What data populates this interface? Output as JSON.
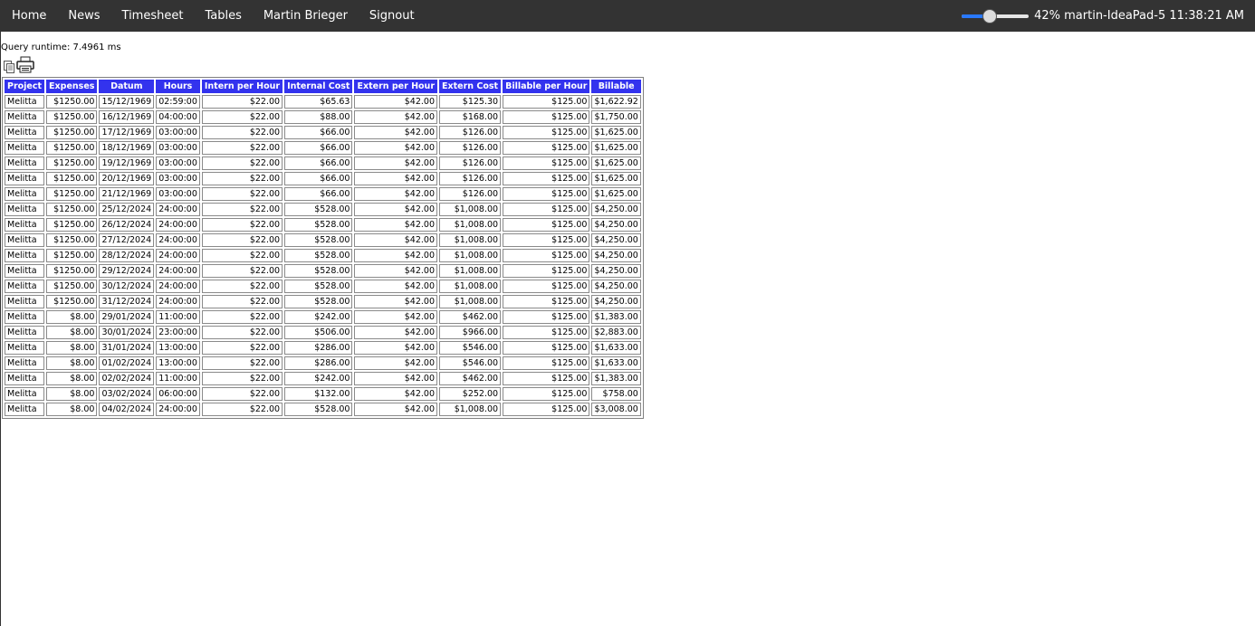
{
  "nav": {
    "items": [
      "Home",
      "News",
      "Timesheet",
      "Tables",
      "Martin Brieger",
      "Signout"
    ]
  },
  "status": {
    "volume_fraction": 0.42,
    "text": "42% martin-IdeaPad-5 11:38:21 AM"
  },
  "runtime": "Query runtime: 7.4961 ms",
  "icons": {
    "copy": "copy-icon",
    "print": "printer-icon"
  },
  "colors": {
    "topbar": "#333333",
    "header": "#3333ee",
    "slider": "#2979ff"
  },
  "table": {
    "headers": [
      "Project",
      "Expenses",
      "Datum",
      "Hours",
      "Intern per Hour",
      "Internal Cost",
      "Extern per Hour",
      "Extern Cost",
      "Billable per Hour",
      "Billable"
    ],
    "rows": [
      [
        "Melitta",
        "$1250.00",
        "15/12/1969",
        "02:59:00",
        "$22.00",
        "$65.63",
        "$42.00",
        "$125.30",
        "$125.00",
        "$1,622.92"
      ],
      [
        "Melitta",
        "$1250.00",
        "16/12/1969",
        "04:00:00",
        "$22.00",
        "$88.00",
        "$42.00",
        "$168.00",
        "$125.00",
        "$1,750.00"
      ],
      [
        "Melitta",
        "$1250.00",
        "17/12/1969",
        "03:00:00",
        "$22.00",
        "$66.00",
        "$42.00",
        "$126.00",
        "$125.00",
        "$1,625.00"
      ],
      [
        "Melitta",
        "$1250.00",
        "18/12/1969",
        "03:00:00",
        "$22.00",
        "$66.00",
        "$42.00",
        "$126.00",
        "$125.00",
        "$1,625.00"
      ],
      [
        "Melitta",
        "$1250.00",
        "19/12/1969",
        "03:00:00",
        "$22.00",
        "$66.00",
        "$42.00",
        "$126.00",
        "$125.00",
        "$1,625.00"
      ],
      [
        "Melitta",
        "$1250.00",
        "20/12/1969",
        "03:00:00",
        "$22.00",
        "$66.00",
        "$42.00",
        "$126.00",
        "$125.00",
        "$1,625.00"
      ],
      [
        "Melitta",
        "$1250.00",
        "21/12/1969",
        "03:00:00",
        "$22.00",
        "$66.00",
        "$42.00",
        "$126.00",
        "$125.00",
        "$1,625.00"
      ],
      [
        "Melitta",
        "$1250.00",
        "25/12/2024",
        "24:00:00",
        "$22.00",
        "$528.00",
        "$42.00",
        "$1,008.00",
        "$125.00",
        "$4,250.00"
      ],
      [
        "Melitta",
        "$1250.00",
        "26/12/2024",
        "24:00:00",
        "$22.00",
        "$528.00",
        "$42.00",
        "$1,008.00",
        "$125.00",
        "$4,250.00"
      ],
      [
        "Melitta",
        "$1250.00",
        "27/12/2024",
        "24:00:00",
        "$22.00",
        "$528.00",
        "$42.00",
        "$1,008.00",
        "$125.00",
        "$4,250.00"
      ],
      [
        "Melitta",
        "$1250.00",
        "28/12/2024",
        "24:00:00",
        "$22.00",
        "$528.00",
        "$42.00",
        "$1,008.00",
        "$125.00",
        "$4,250.00"
      ],
      [
        "Melitta",
        "$1250.00",
        "29/12/2024",
        "24:00:00",
        "$22.00",
        "$528.00",
        "$42.00",
        "$1,008.00",
        "$125.00",
        "$4,250.00"
      ],
      [
        "Melitta",
        "$1250.00",
        "30/12/2024",
        "24:00:00",
        "$22.00",
        "$528.00",
        "$42.00",
        "$1,008.00",
        "$125.00",
        "$4,250.00"
      ],
      [
        "Melitta",
        "$1250.00",
        "31/12/2024",
        "24:00:00",
        "$22.00",
        "$528.00",
        "$42.00",
        "$1,008.00",
        "$125.00",
        "$4,250.00"
      ],
      [
        "Melitta",
        "$8.00",
        "29/01/2024",
        "11:00:00",
        "$22.00",
        "$242.00",
        "$42.00",
        "$462.00",
        "$125.00",
        "$1,383.00"
      ],
      [
        "Melitta",
        "$8.00",
        "30/01/2024",
        "23:00:00",
        "$22.00",
        "$506.00",
        "$42.00",
        "$966.00",
        "$125.00",
        "$2,883.00"
      ],
      [
        "Melitta",
        "$8.00",
        "31/01/2024",
        "13:00:00",
        "$22.00",
        "$286.00",
        "$42.00",
        "$546.00",
        "$125.00",
        "$1,633.00"
      ],
      [
        "Melitta",
        "$8.00",
        "01/02/2024",
        "13:00:00",
        "$22.00",
        "$286.00",
        "$42.00",
        "$546.00",
        "$125.00",
        "$1,633.00"
      ],
      [
        "Melitta",
        "$8.00",
        "02/02/2024",
        "11:00:00",
        "$22.00",
        "$242.00",
        "$42.00",
        "$462.00",
        "$125.00",
        "$1,383.00"
      ],
      [
        "Melitta",
        "$8.00",
        "03/02/2024",
        "06:00:00",
        "$22.00",
        "$132.00",
        "$42.00",
        "$252.00",
        "$125.00",
        "$758.00"
      ],
      [
        "Melitta",
        "$8.00",
        "04/02/2024",
        "24:00:00",
        "$22.00",
        "$528.00",
        "$42.00",
        "$1,008.00",
        "$125.00",
        "$3,008.00"
      ]
    ]
  }
}
